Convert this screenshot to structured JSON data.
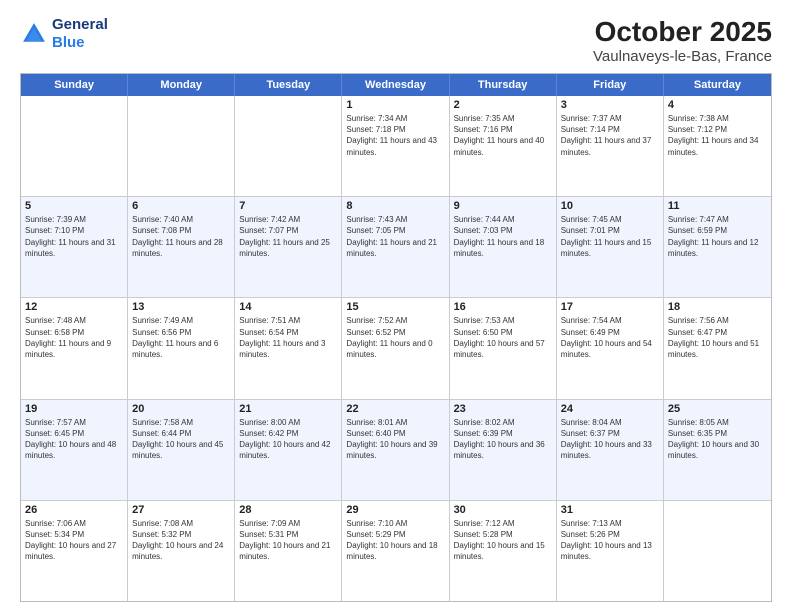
{
  "header": {
    "logo_line1": "General",
    "logo_line2": "Blue",
    "month": "October 2025",
    "location": "Vaulnaveys-le-Bas, France"
  },
  "days_of_week": [
    "Sunday",
    "Monday",
    "Tuesday",
    "Wednesday",
    "Thursday",
    "Friday",
    "Saturday"
  ],
  "weeks": [
    [
      {
        "day": "",
        "sunrise": "",
        "sunset": "",
        "daylight": ""
      },
      {
        "day": "",
        "sunrise": "",
        "sunset": "",
        "daylight": ""
      },
      {
        "day": "",
        "sunrise": "",
        "sunset": "",
        "daylight": ""
      },
      {
        "day": "1",
        "sunrise": "Sunrise: 7:34 AM",
        "sunset": "Sunset: 7:18 PM",
        "daylight": "Daylight: 11 hours and 43 minutes."
      },
      {
        "day": "2",
        "sunrise": "Sunrise: 7:35 AM",
        "sunset": "Sunset: 7:16 PM",
        "daylight": "Daylight: 11 hours and 40 minutes."
      },
      {
        "day": "3",
        "sunrise": "Sunrise: 7:37 AM",
        "sunset": "Sunset: 7:14 PM",
        "daylight": "Daylight: 11 hours and 37 minutes."
      },
      {
        "day": "4",
        "sunrise": "Sunrise: 7:38 AM",
        "sunset": "Sunset: 7:12 PM",
        "daylight": "Daylight: 11 hours and 34 minutes."
      }
    ],
    [
      {
        "day": "5",
        "sunrise": "Sunrise: 7:39 AM",
        "sunset": "Sunset: 7:10 PM",
        "daylight": "Daylight: 11 hours and 31 minutes."
      },
      {
        "day": "6",
        "sunrise": "Sunrise: 7:40 AM",
        "sunset": "Sunset: 7:08 PM",
        "daylight": "Daylight: 11 hours and 28 minutes."
      },
      {
        "day": "7",
        "sunrise": "Sunrise: 7:42 AM",
        "sunset": "Sunset: 7:07 PM",
        "daylight": "Daylight: 11 hours and 25 minutes."
      },
      {
        "day": "8",
        "sunrise": "Sunrise: 7:43 AM",
        "sunset": "Sunset: 7:05 PM",
        "daylight": "Daylight: 11 hours and 21 minutes."
      },
      {
        "day": "9",
        "sunrise": "Sunrise: 7:44 AM",
        "sunset": "Sunset: 7:03 PM",
        "daylight": "Daylight: 11 hours and 18 minutes."
      },
      {
        "day": "10",
        "sunrise": "Sunrise: 7:45 AM",
        "sunset": "Sunset: 7:01 PM",
        "daylight": "Daylight: 11 hours and 15 minutes."
      },
      {
        "day": "11",
        "sunrise": "Sunrise: 7:47 AM",
        "sunset": "Sunset: 6:59 PM",
        "daylight": "Daylight: 11 hours and 12 minutes."
      }
    ],
    [
      {
        "day": "12",
        "sunrise": "Sunrise: 7:48 AM",
        "sunset": "Sunset: 6:58 PM",
        "daylight": "Daylight: 11 hours and 9 minutes."
      },
      {
        "day": "13",
        "sunrise": "Sunrise: 7:49 AM",
        "sunset": "Sunset: 6:56 PM",
        "daylight": "Daylight: 11 hours and 6 minutes."
      },
      {
        "day": "14",
        "sunrise": "Sunrise: 7:51 AM",
        "sunset": "Sunset: 6:54 PM",
        "daylight": "Daylight: 11 hours and 3 minutes."
      },
      {
        "day": "15",
        "sunrise": "Sunrise: 7:52 AM",
        "sunset": "Sunset: 6:52 PM",
        "daylight": "Daylight: 11 hours and 0 minutes."
      },
      {
        "day": "16",
        "sunrise": "Sunrise: 7:53 AM",
        "sunset": "Sunset: 6:50 PM",
        "daylight": "Daylight: 10 hours and 57 minutes."
      },
      {
        "day": "17",
        "sunrise": "Sunrise: 7:54 AM",
        "sunset": "Sunset: 6:49 PM",
        "daylight": "Daylight: 10 hours and 54 minutes."
      },
      {
        "day": "18",
        "sunrise": "Sunrise: 7:56 AM",
        "sunset": "Sunset: 6:47 PM",
        "daylight": "Daylight: 10 hours and 51 minutes."
      }
    ],
    [
      {
        "day": "19",
        "sunrise": "Sunrise: 7:57 AM",
        "sunset": "Sunset: 6:45 PM",
        "daylight": "Daylight: 10 hours and 48 minutes."
      },
      {
        "day": "20",
        "sunrise": "Sunrise: 7:58 AM",
        "sunset": "Sunset: 6:44 PM",
        "daylight": "Daylight: 10 hours and 45 minutes."
      },
      {
        "day": "21",
        "sunrise": "Sunrise: 8:00 AM",
        "sunset": "Sunset: 6:42 PM",
        "daylight": "Daylight: 10 hours and 42 minutes."
      },
      {
        "day": "22",
        "sunrise": "Sunrise: 8:01 AM",
        "sunset": "Sunset: 6:40 PM",
        "daylight": "Daylight: 10 hours and 39 minutes."
      },
      {
        "day": "23",
        "sunrise": "Sunrise: 8:02 AM",
        "sunset": "Sunset: 6:39 PM",
        "daylight": "Daylight: 10 hours and 36 minutes."
      },
      {
        "day": "24",
        "sunrise": "Sunrise: 8:04 AM",
        "sunset": "Sunset: 6:37 PM",
        "daylight": "Daylight: 10 hours and 33 minutes."
      },
      {
        "day": "25",
        "sunrise": "Sunrise: 8:05 AM",
        "sunset": "Sunset: 6:35 PM",
        "daylight": "Daylight: 10 hours and 30 minutes."
      }
    ],
    [
      {
        "day": "26",
        "sunrise": "Sunrise: 7:06 AM",
        "sunset": "Sunset: 5:34 PM",
        "daylight": "Daylight: 10 hours and 27 minutes."
      },
      {
        "day": "27",
        "sunrise": "Sunrise: 7:08 AM",
        "sunset": "Sunset: 5:32 PM",
        "daylight": "Daylight: 10 hours and 24 minutes."
      },
      {
        "day": "28",
        "sunrise": "Sunrise: 7:09 AM",
        "sunset": "Sunset: 5:31 PM",
        "daylight": "Daylight: 10 hours and 21 minutes."
      },
      {
        "day": "29",
        "sunrise": "Sunrise: 7:10 AM",
        "sunset": "Sunset: 5:29 PM",
        "daylight": "Daylight: 10 hours and 18 minutes."
      },
      {
        "day": "30",
        "sunrise": "Sunrise: 7:12 AM",
        "sunset": "Sunset: 5:28 PM",
        "daylight": "Daylight: 10 hours and 15 minutes."
      },
      {
        "day": "31",
        "sunrise": "Sunrise: 7:13 AM",
        "sunset": "Sunset: 5:26 PM",
        "daylight": "Daylight: 10 hours and 13 minutes."
      },
      {
        "day": "",
        "sunrise": "",
        "sunset": "",
        "daylight": ""
      }
    ]
  ]
}
